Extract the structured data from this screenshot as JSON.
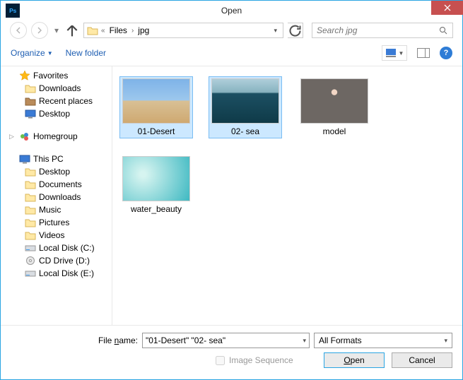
{
  "window": {
    "title": "Open"
  },
  "nav": {
    "crumbs": [
      "Files",
      "jpg"
    ],
    "search_placeholder": "Search jpg"
  },
  "toolbar": {
    "organize_label": "Organize",
    "newfolder_label": "New folder"
  },
  "tree": {
    "favorites": {
      "label": "Favorites",
      "items": [
        "Downloads",
        "Recent places",
        "Desktop"
      ]
    },
    "homegroup": {
      "label": "Homegroup"
    },
    "thispc": {
      "label": "This PC",
      "items": [
        "Desktop",
        "Documents",
        "Downloads",
        "Music",
        "Pictures",
        "Videos",
        "Local Disk (C:)",
        "CD Drive (D:)",
        "Local Disk (E:)"
      ]
    }
  },
  "files": [
    {
      "name": "01-Desert",
      "selected": true,
      "thumb": "desert"
    },
    {
      "name": "02- sea",
      "selected": true,
      "thumb": "sea"
    },
    {
      "name": "model",
      "selected": false,
      "thumb": "model"
    },
    {
      "name": "water_beauty",
      "selected": false,
      "thumb": "water"
    }
  ],
  "footer": {
    "filename_label_pre": "File ",
    "filename_label_u": "n",
    "filename_label_post": "ame:",
    "filename_value": "\"01-Desert\" \"02- sea\"",
    "filetype_value": "All Formats",
    "image_sequence_label": "Image Sequence",
    "open_u": "O",
    "open_rest": "pen",
    "cancel_label": "Cancel"
  }
}
